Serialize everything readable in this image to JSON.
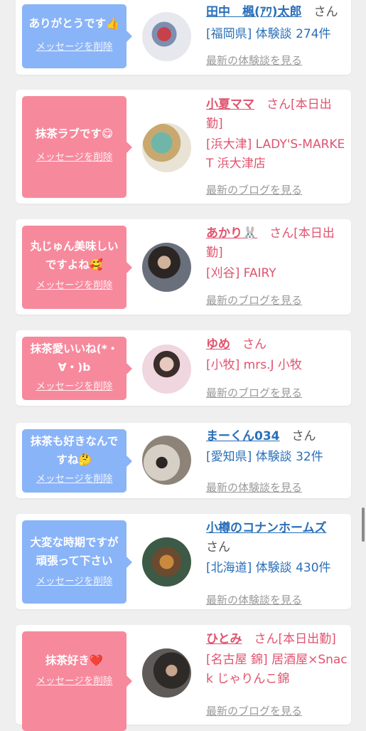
{
  "items": [
    {
      "message": "ありがとうです👍",
      "delete_label": "メッセージを削除",
      "bubble_color": "blue",
      "name": "田中　楓(ｱﾜ)太郎",
      "name_suffix": "さん",
      "detail": "[福岡県] 体験談 274件",
      "link": "最新の体験談を見る"
    },
    {
      "message": "抹茶ラブです😋",
      "delete_label": "メッセージを削除",
      "bubble_color": "pink",
      "name": "小夏ママ",
      "name_suffix": "さん[本日出勤]",
      "detail": "[浜大津] LADY'S-MARKET 浜大津店",
      "link": "最新のブログを見る"
    },
    {
      "message": "丸じゅん美味しいですよね🥰",
      "delete_label": "メッセージを削除",
      "bubble_color": "pink",
      "name": "あかり🐰",
      "name_suffix": "さん[本日出勤]",
      "detail": "[刈谷] FAIRY",
      "link": "最新のブログを見る"
    },
    {
      "message": "抹茶愛いいね(*・∀・)b",
      "delete_label": "メッセージを削除",
      "bubble_color": "pink",
      "name": "ゆめ",
      "name_suffix": "さん",
      "detail": "[小牧] mrs.J 小牧",
      "link": "最新のブログを見る"
    },
    {
      "message": "抹茶も好きなんですね🤔",
      "delete_label": "メッセージを削除",
      "bubble_color": "blue",
      "name": "まーくん034",
      "name_suffix": "さん",
      "detail": "[愛知県] 体験談 32件",
      "link": "最新の体験談を見る"
    },
    {
      "message": "大変な時期ですが頑張って下さい",
      "delete_label": "メッセージを削除",
      "bubble_color": "blue",
      "name": "小樽のコナンホームズ",
      "name_suffix": "さん",
      "detail": "[北海道] 体験談 430件",
      "link": "最新の体験談を見る"
    },
    {
      "message": "抹茶好き❤️",
      "delete_label": "メッセージを削除",
      "bubble_color": "pink",
      "name": "ひとみ",
      "name_suffix": "さん[本日出勤]",
      "detail": "[名古屋 錦] 居酒屋×Snack じゃりんこ錦",
      "link": "最新のブログを見る"
    }
  ],
  "colors": {
    "blue_bubble": "#8ab4f8",
    "pink_bubble": "#f7899d",
    "blue_text": "#2a6fb8",
    "pink_text": "#e0536e"
  }
}
